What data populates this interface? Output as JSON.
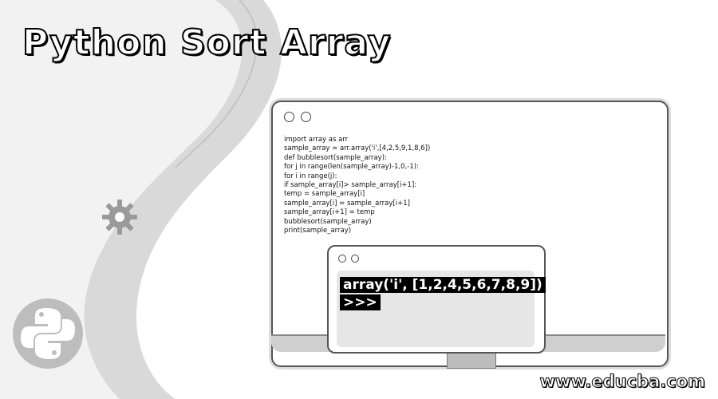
{
  "title": "Python Sort Array",
  "code_window": {
    "lines": [
      "import array as arr",
      "sample_array = arr.array('i',[4,2,5,9,1,8,6])",
      "def bubblesort(sample_array):",
      "for j in range(len(sample_array)-1,0,-1):",
      "for i in range(j):",
      "if sample_array[i]> sample_array[i+1]:",
      "temp = sample_array[i]",
      "sample_array[i] = sample_array[i+1]",
      "sample_array[i+1] = temp",
      "bubblesort(sample_array)",
      "print(sample_array)"
    ]
  },
  "output_window": {
    "result": "array('i', [1,2,4,5,6,7,8,9])",
    "prompt": ">>>"
  },
  "footer": {
    "url": "www.educba.com"
  },
  "icons": [
    "gear-icon",
    "python-logo-icon"
  ]
}
